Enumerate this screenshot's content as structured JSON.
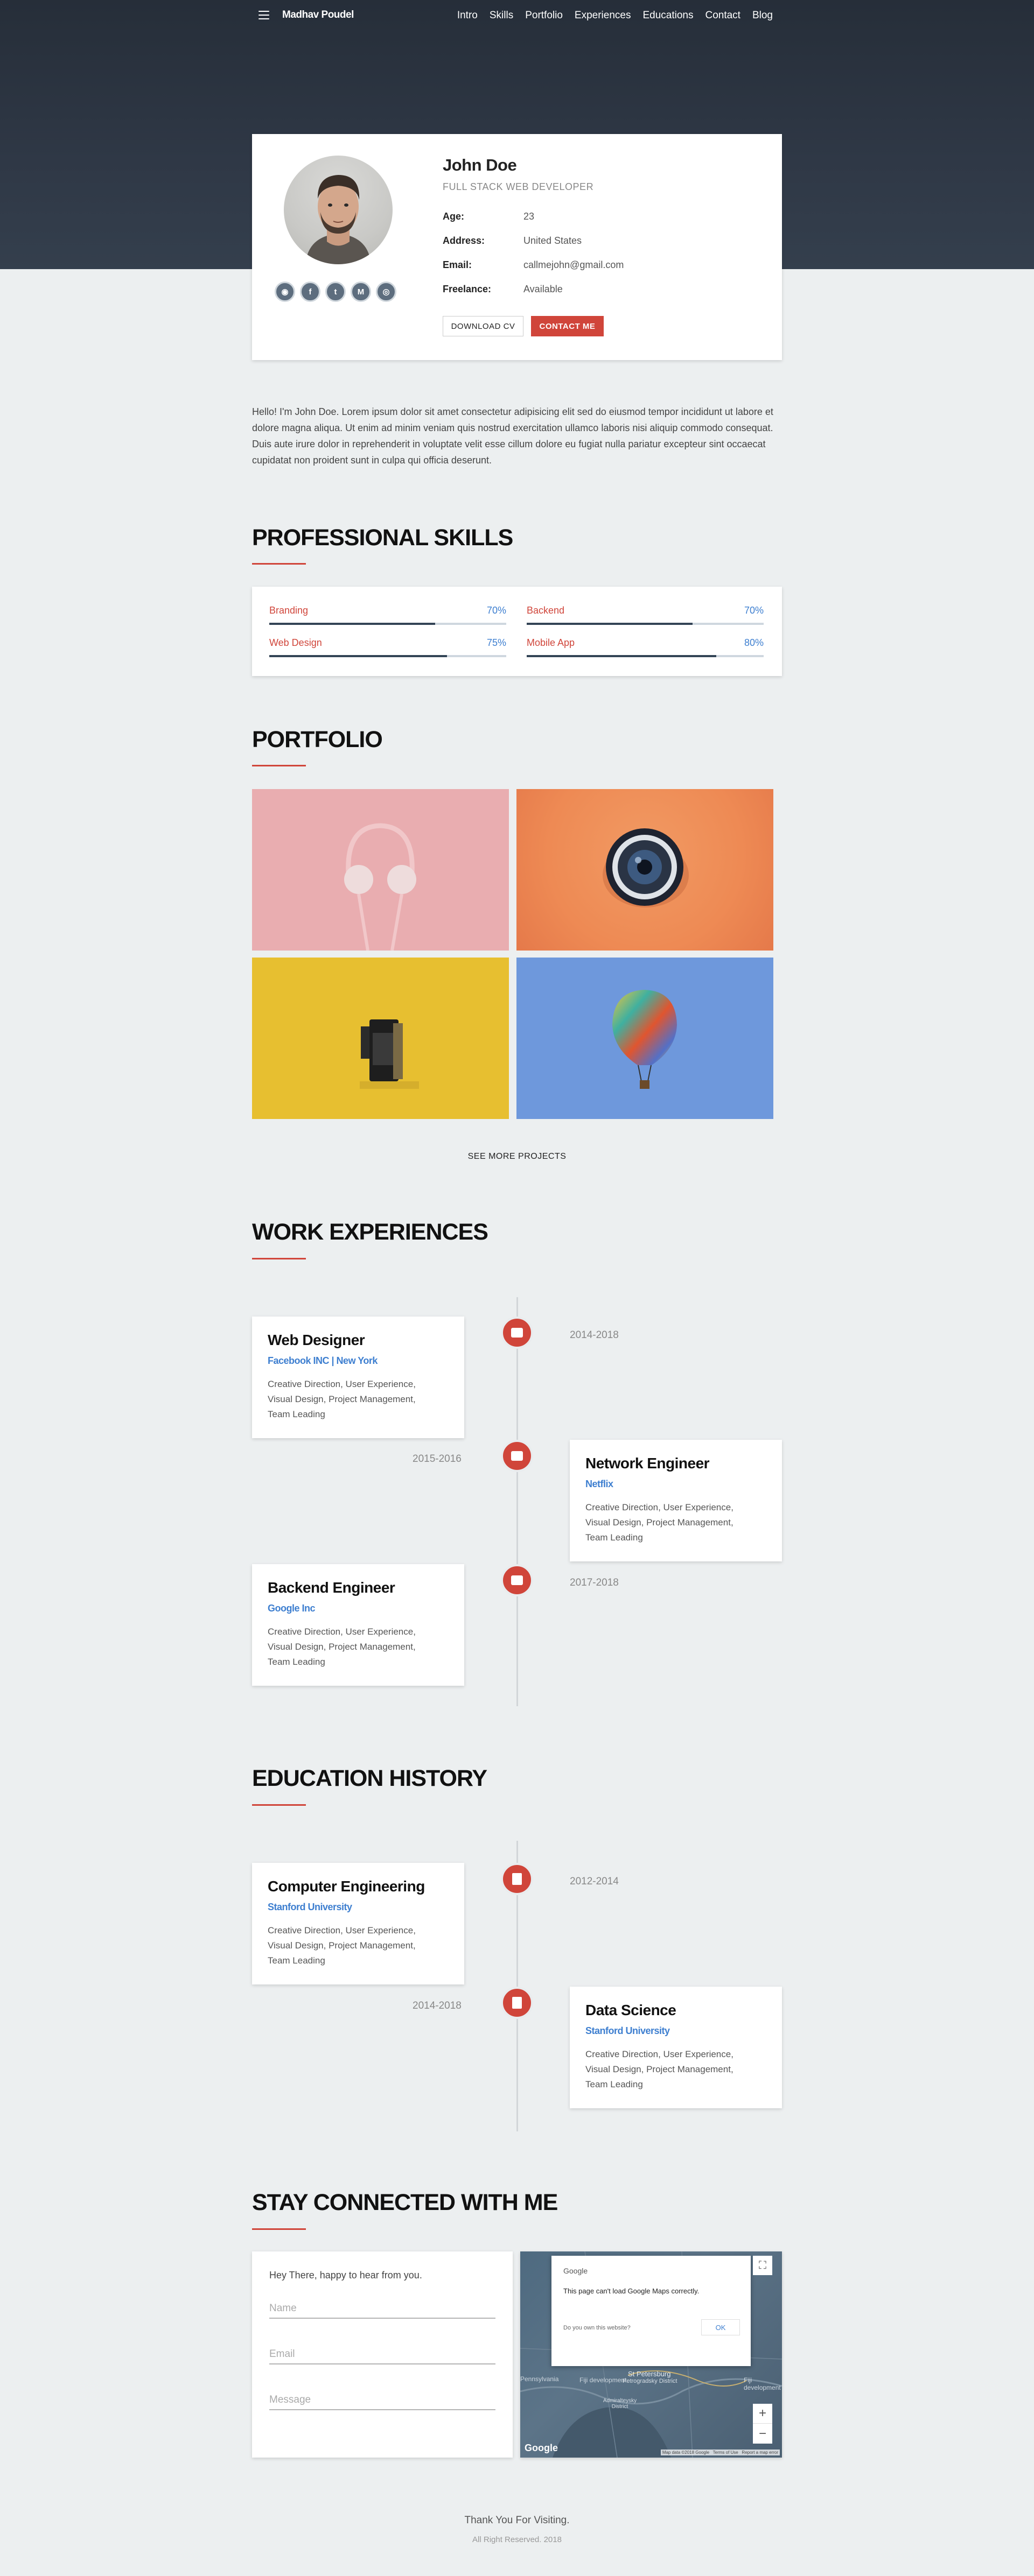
{
  "nav": {
    "brand": "Madhav Poudel",
    "links": [
      "Intro",
      "Skills",
      "Portfolio",
      "Experiences",
      "Educations",
      "Contact",
      "Blog"
    ]
  },
  "profile": {
    "name": "John Doe",
    "role": "FULL STACK WEB DEVELOPER",
    "fields": [
      {
        "key": "Age:",
        "value": "23"
      },
      {
        "key": "Address:",
        "value": "United States"
      },
      {
        "key": "Email:",
        "value": "callmejohn@gmail.com"
      },
      {
        "key": "Freelance:",
        "value": "Available"
      }
    ],
    "social_icons": [
      "github-icon",
      "facebook-icon",
      "twitter-icon",
      "medium-icon",
      "instagram-icon"
    ],
    "download_label": "DOWNLOAD CV",
    "contact_label": "CONTACT ME"
  },
  "bio": "Hello! I'm John Doe. Lorem ipsum dolor sit amet consectetur adipisicing elit sed do eiusmod tempor incididunt ut labore et dolore magna aliqua. Ut enim ad minim veniam quis nostrud exercitation ullamco laboris nisi aliquip commodo consequat. Duis aute irure dolor in reprehenderit in voluptate velit esse cillum dolore eu fugiat nulla pariatur excepteur sint occaecat cupidatat non proident sunt in culpa qui officia deserunt.",
  "skills": {
    "title": "PROFESSIONAL SKILLS",
    "items": [
      {
        "name": "Branding",
        "percent": "70%",
        "level": 0.7
      },
      {
        "name": "Backend",
        "percent": "70%",
        "level": 0.7
      },
      {
        "name": "Web Design",
        "percent": "75%",
        "level": 0.75
      },
      {
        "name": "Mobile App",
        "percent": "80%",
        "level": 0.8
      }
    ]
  },
  "portfolio": {
    "title": "PORTFOLIO",
    "see_more": "SEE MORE PROJECTS"
  },
  "experience": {
    "title": "WORK EXPERIENCES",
    "items": [
      {
        "title": "Web Designer",
        "company": "Facebook INC | New York",
        "desc": "Creative Direction, User Experience, Visual Design, Project Management, Team Leading",
        "years": "2014-2018"
      },
      {
        "title": "Network Engineer",
        "company": "Netflix",
        "desc": "Creative Direction, User Experience, Visual Design, Project Management, Team Leading",
        "years": "2015-2016"
      },
      {
        "title": "Backend Engineer",
        "company": "Google Inc",
        "desc": "Creative Direction, User Experience, Visual Design, Project Management, Team Leading",
        "years": "2017-2018"
      }
    ]
  },
  "education": {
    "title": "EDUCATION HISTORY",
    "items": [
      {
        "title": "Computer Engineering",
        "company": "Stanford University",
        "desc": "Creative Direction, User Experience, Visual Design, Project Management, Team Leading",
        "years": "2012-2014"
      },
      {
        "title": "Data Science",
        "company": "Stanford University",
        "desc": "Creative Direction, User Experience, Visual Design, Project Management, Team Leading",
        "years": "2014-2018"
      }
    ]
  },
  "contact": {
    "title": "STAY CONNECTED WITH ME",
    "greeting": "Hey There, happy to hear from you.",
    "name_placeholder": "Name",
    "email_placeholder": "Email",
    "message_placeholder": "Message"
  },
  "map": {
    "dialog_brand": "Google",
    "dialog_msg": "This page can't load Google Maps correctly.",
    "dialog_question": "Do you own this website?",
    "dialog_ok": "OK",
    "logo": "Google",
    "attribution": "Map data ©2018 Google   Terms of Use   Report a map error",
    "labels": [
      "Pennsylvania",
      "St Petersburg",
      "Fiji development",
      "Fiji development",
      "Petrogradsky District",
      "Admiralteysky District"
    ],
    "zoom_in": "+",
    "zoom_out": "−"
  },
  "footer": {
    "thanks": "Thank You For Visiting.",
    "rights": "All Right Reserved. 2018"
  }
}
